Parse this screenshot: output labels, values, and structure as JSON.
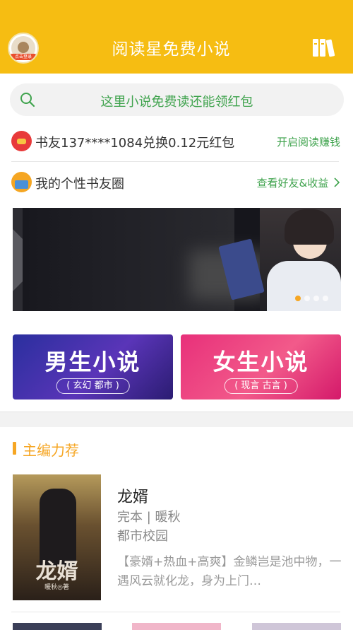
{
  "header": {
    "title": "阅读星免费小说",
    "avatar_tag": "点击登录",
    "bg_color": "#f6bd12"
  },
  "search": {
    "placeholder": "这里小说免费读还能领红包",
    "icon": "search-icon"
  },
  "notice": {
    "text": "书友137****1084兑换0.12元红包",
    "link": "开启阅读赚钱",
    "icon": "red-packet-icon"
  },
  "circle": {
    "text": "我的个性书友圈",
    "link": "查看好友&收益",
    "icon": "book-circle-icon"
  },
  "banner": {
    "slides": 4,
    "active_slide": 1
  },
  "categories": [
    {
      "title": "男生小说",
      "subtitle": "( 玄幻  都市 )"
    },
    {
      "title": "女生小说",
      "subtitle": "( 现言  古言 )"
    }
  ],
  "section": {
    "title": "主编力荐",
    "accent_color": "#f6a623"
  },
  "book": {
    "title": "龙婿",
    "meta": "完本 | 暖秋",
    "category": "都市校园",
    "description": "【豪婿+热血+高爽】金鳞岂是池中物，一遇风云就化龙，身为上门…",
    "cover_title": "龙婿",
    "cover_author": "暖秋◎著"
  }
}
